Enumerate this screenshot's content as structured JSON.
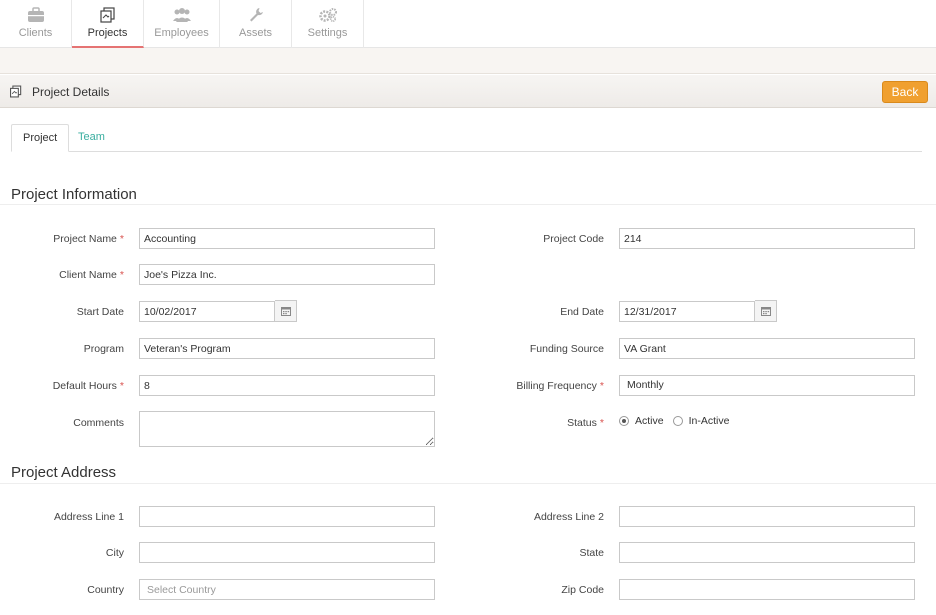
{
  "nav": {
    "items": [
      {
        "label": "Clients",
        "icon": "briefcase-icon"
      },
      {
        "label": "Projects",
        "icon": "projects-icon"
      },
      {
        "label": "Employees",
        "icon": "people-icon"
      },
      {
        "label": "Assets",
        "icon": "wrench-icon"
      },
      {
        "label": "Settings",
        "icon": "gears-icon"
      }
    ],
    "active": "Projects"
  },
  "header": {
    "title": "Project Details",
    "back_label": "Back"
  },
  "tabs": [
    {
      "label": "Project"
    },
    {
      "label": "Team"
    }
  ],
  "sections": {
    "info_title": "Project Information",
    "address_title": "Project Address"
  },
  "form": {
    "project_name": {
      "label": "Project Name",
      "value": "Accounting"
    },
    "project_code": {
      "label": "Project Code",
      "value": "214"
    },
    "client_name": {
      "label": "Client Name",
      "value": "Joe's Pizza Inc."
    },
    "start_date": {
      "label": "Start Date",
      "value": "10/02/2017"
    },
    "end_date": {
      "label": "End Date",
      "value": "12/31/2017"
    },
    "program": {
      "label": "Program",
      "value": "Veteran's Program"
    },
    "funding_source": {
      "label": "Funding Source",
      "value": "VA Grant"
    },
    "default_hours": {
      "label": "Default Hours",
      "value": "8"
    },
    "billing_frequency": {
      "label": "Billing Frequency",
      "value": "Monthly"
    },
    "comments": {
      "label": "Comments",
      "value": ""
    },
    "status": {
      "label": "Status",
      "options": [
        "Active",
        "In-Active"
      ],
      "selected": "Active"
    },
    "address_line_1": {
      "label": "Address Line 1",
      "value": ""
    },
    "address_line_2": {
      "label": "Address Line 2",
      "value": ""
    },
    "city": {
      "label": "City",
      "value": ""
    },
    "state": {
      "label": "State",
      "value": ""
    },
    "country": {
      "label": "Country",
      "placeholder": "Select Country"
    },
    "zip_code": {
      "label": "Zip Code",
      "value": ""
    }
  },
  "colors": {
    "accent_button": "#f0a030",
    "tab_link": "#3aaea0",
    "required": "#d9534f",
    "nav_active_underline": "#e57373"
  }
}
